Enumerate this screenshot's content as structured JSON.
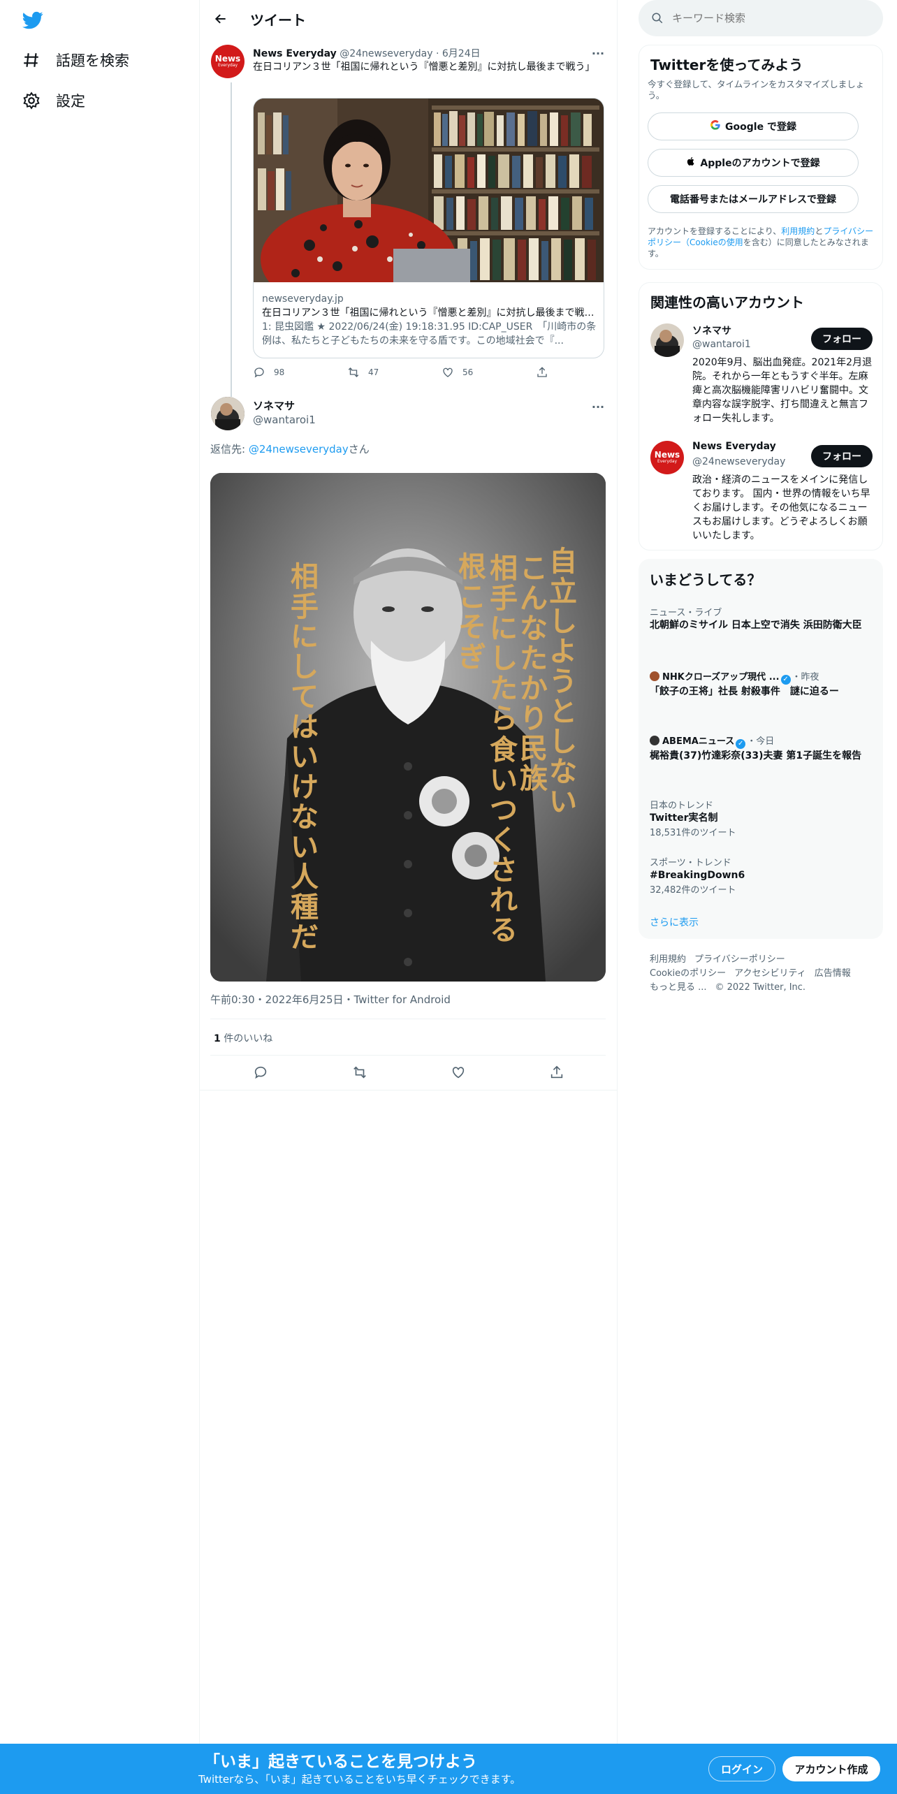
{
  "nav": {
    "explore_label": "話題を検索",
    "settings_label": "設定"
  },
  "header": {
    "title": "ツイート"
  },
  "quoted_tweet": {
    "author_name": "News Everyday",
    "author_handle": "@24newseveryday",
    "date": "· 6月24日",
    "avatar_text_top": "News",
    "avatar_text_bottom": "Everyday",
    "text": "在日コリアン３世「祖国に帰れという『憎悪と差別』に対抗し最後まで戦う」",
    "card": {
      "domain": "newseveryday.jp",
      "title": "在日コリアン３世「祖国に帰れという『憎悪と差別』に対抗し最後まで戦う」",
      "description": "1: 昆虫図鑑 ★ 2022/06/24(金) 19:18:31.95 ID:CAP_USER　「川崎市の条例は、私たちと子どもたちの未来を守る盾です。この地域社会で『..."
    },
    "replies": "98",
    "retweets": "47",
    "likes": "56"
  },
  "main_tweet": {
    "author_name": "ソネマサ",
    "author_handle": "@wantaroi1",
    "reply_prefix": "返信先: ",
    "reply_to": "@24newseveryday",
    "reply_suffix": "さん",
    "photo_text_col1": "自立しようとしない",
    "photo_text_col2": "こんなたかり民族",
    "photo_text_col3": "相手にしたら",
    "photo_text_col4": "根こそぎ食いつくされる",
    "photo_text_col5": "相手にしてはいけない人種だ",
    "meta": "午前0:30・2022年6月25日・Twitter for Android",
    "like_count": "1",
    "like_label": " 件のいいね"
  },
  "search": {
    "placeholder": "キーワード検索"
  },
  "signup": {
    "title": "Twitterを使ってみよう",
    "subtitle": "今すぐ登録して、タイムラインをカスタマイズしましょう。",
    "google": "Google で登録",
    "apple": "Appleのアカウントで登録",
    "phone": "電話番号またはメールアドレスで登録",
    "terms_pre": "アカウントを登録することにより、",
    "terms_link1": "利用規約",
    "terms_mid": "と",
    "terms_link2": "プライバシーポリシー（Cookieの使用",
    "terms_post": "を含む）に同意したとみなされます。"
  },
  "relevant": {
    "title": "関連性の高いアカウント",
    "accounts": [
      {
        "name": "ソネマサ",
        "handle": "@wantaroi1",
        "follow": "フォロー",
        "bio": "2020年9月、脳出血発症。2021年2月退院。それから一年ともうすぐ半年。左麻痺と高次脳機能障害リハビリ奮闘中。文章内容な誤字脱字、打ち間違えと無言フォロー失礼します。"
      },
      {
        "name": "News Everyday",
        "handle": "@24newseveryday",
        "follow": "フォロー",
        "bio": "政治・経済のニュースをメインに発信しております。 国内・世界の情報をいち早くお届けします。その他気になるニュースもお届けします。どうぞよろしくお願いいたします。"
      }
    ]
  },
  "trends": {
    "title": "いまどうしてる？",
    "items": [
      {
        "category": "ニュース・ライブ",
        "title": "北朝鮮のミサイル 日本上空で消失 浜田防衛大臣",
        "count": ""
      },
      {
        "category": "NHKクローズアップ現代 ...",
        "category_suffix": "・昨夜",
        "title": "「餃子の王将」社長 射殺事件　謎に迫るー",
        "count": ""
      },
      {
        "category": "ABEMAニュース",
        "category_suffix": "・今日",
        "title": "梶裕貴(37)竹達彩奈(33)夫妻 第1子誕生を報告",
        "count": ""
      },
      {
        "category": "日本のトレンド",
        "title": "Twitter実名制",
        "count": "18,531件のツイート"
      },
      {
        "category": "スポーツ・トレンド",
        "title": "#BreakingDown6",
        "count": "32,482件のツイート"
      }
    ],
    "show_more": "さらに表示"
  },
  "footer": {
    "terms": "利用規約",
    "privacy": "プライバシーポリシー",
    "cookie": "Cookieのポリシー",
    "accessibility": "アクセシビリティ",
    "ads": "広告情報",
    "more": "もっと見る ...",
    "copyright": "© 2022 Twitter, Inc."
  },
  "bottom_bar": {
    "headline": "「いま」起きていることを見つけよう",
    "sub": "Twitterなら、「いま」起きていることをいち早くチェックできます。",
    "login": "ログイン",
    "signup": "アカウント作成"
  },
  "colors": {
    "accent": "#1d9bf0",
    "text": "#0f1419",
    "muted": "#536471",
    "brand_red": "#d21a1a"
  }
}
